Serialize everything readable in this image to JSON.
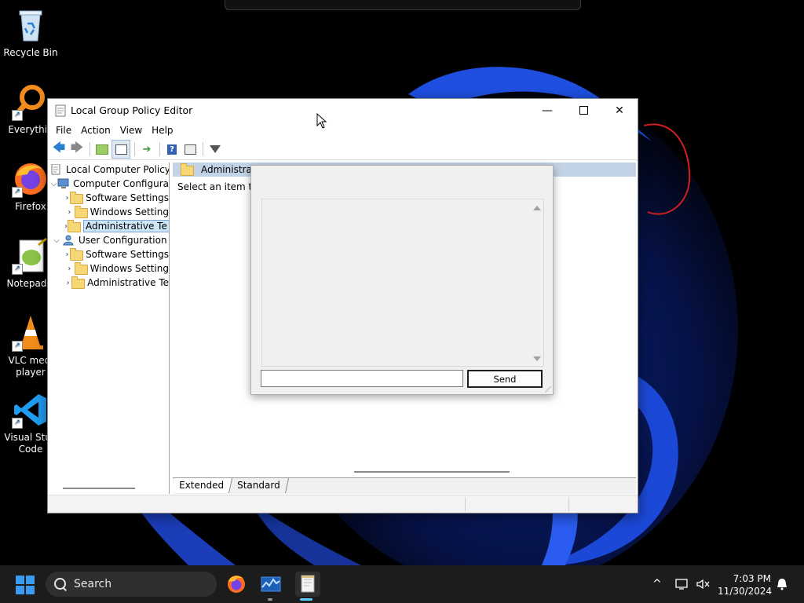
{
  "desktop": {
    "icons": [
      {
        "label": "Recycle Bin"
      },
      {
        "label": "Everythin"
      },
      {
        "label": "Firefox"
      },
      {
        "label": "Notepad+"
      },
      {
        "label": "VLC medi player"
      },
      {
        "label": "Visual Stud Code"
      }
    ]
  },
  "gpe": {
    "title": "Local Group Policy Editor",
    "menu": [
      "File",
      "Action",
      "View",
      "Help"
    ],
    "tree": {
      "root": "Local Computer Policy",
      "computer": "Computer Configura",
      "computer_children": [
        "Software Settings",
        "Windows Setting",
        "Administrative Te"
      ],
      "user": "User Configuration",
      "user_children": [
        "Software Settings",
        "Windows Setting",
        "Administrative Te"
      ]
    },
    "right": {
      "header": "Administrati",
      "text": "Select an item to v"
    },
    "tabs": [
      "Extended",
      "Standard"
    ]
  },
  "chat": {
    "message": "",
    "input_value": "",
    "send_label": "Send"
  },
  "taskbar": {
    "search_label": "Search",
    "time": "7:03 PM",
    "date": "11/30/2024"
  },
  "colors": {
    "accent": "#3a9bf0",
    "taskbar": "#1c1c1c",
    "selection": "#cde6f7"
  }
}
